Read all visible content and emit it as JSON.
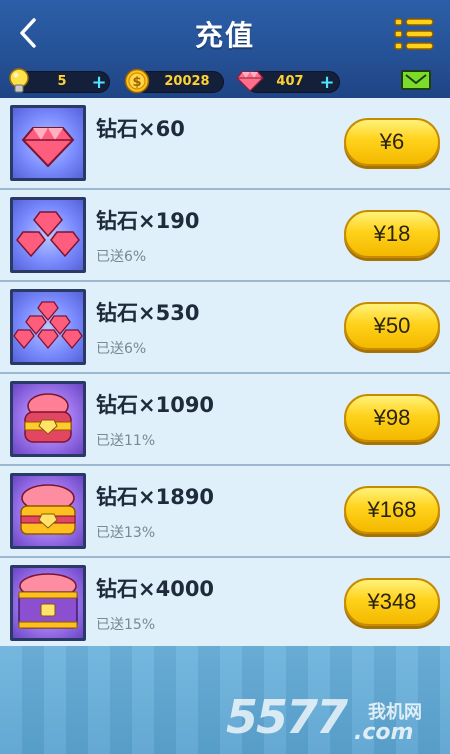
{
  "header": {
    "title": "充值"
  },
  "resources": {
    "energy": "5",
    "coins": "20028",
    "diamonds": "407"
  },
  "products": [
    {
      "name": "钻石×60",
      "bonus": "",
      "price": "¥6",
      "icon": "diamond-single-icon"
    },
    {
      "name": "钻石×190",
      "bonus": "已送6%",
      "price": "¥18",
      "icon": "diamond-trio-icon"
    },
    {
      "name": "钻石×530",
      "bonus": "已送6%",
      "price": "¥50",
      "icon": "diamond-pile-icon"
    },
    {
      "name": "钻石×1090",
      "bonus": "已送11%",
      "price": "¥98",
      "icon": "diamond-chest-small-icon"
    },
    {
      "name": "钻石×1890",
      "bonus": "已送13%",
      "price": "¥168",
      "icon": "diamond-chest-medium-icon"
    },
    {
      "name": "钻石×4000",
      "bonus": "已送15%",
      "price": "¥348",
      "icon": "diamond-chest-large-icon"
    }
  ],
  "watermark": {
    "number": "5577",
    "site_cn": "我机网",
    "domain": ".com"
  },
  "colors": {
    "header_bg": "#2c5fa8",
    "row_bg": "#dff0fb",
    "price_button": "#ffd21a",
    "accent_plus": "#4ee5ff",
    "currency_text": "#ffd234"
  }
}
